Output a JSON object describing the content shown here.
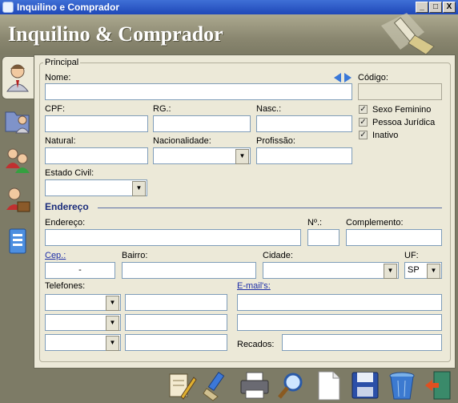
{
  "window": {
    "title": "Inquilino e Comprador",
    "buttons": {
      "minimize": "_",
      "maximize": "□",
      "close": "X"
    }
  },
  "header": {
    "title": "Inquilino & Comprador"
  },
  "sidebar": {
    "tabs": [
      {
        "icon": "person-icon"
      },
      {
        "icon": "folder-person-icon"
      },
      {
        "icon": "two-people-icon"
      },
      {
        "icon": "person-briefcase-icon"
      },
      {
        "icon": "document-book-icon"
      }
    ]
  },
  "form": {
    "group_label": "Principal",
    "nome_label": "Nome:",
    "nome_value": "",
    "codigo_label": "Código:",
    "codigo_value": "",
    "cpf_label": "CPF:",
    "rg_label": "RG.:",
    "nasc_label": "Nasc.:",
    "natural_label": "Natural:",
    "nacionalidade_label": "Nacionalidade:",
    "profissao_label": "Profissão:",
    "estado_civil_label": "Estado Civil:",
    "checkboxes": [
      {
        "label": "Sexo Feminino",
        "checked": true
      },
      {
        "label": "Pessoa Jurídica",
        "checked": true
      },
      {
        "label": "Inativo",
        "checked": true
      }
    ],
    "endereco_section": "Endereço",
    "endereco_label": "Endereço:",
    "numero_label": "Nº.:",
    "complemento_label": "Complemento:",
    "cep_label": "Cep.:",
    "cep_value": "-",
    "bairro_label": "Bairro:",
    "cidade_label": "Cidade:",
    "uf_label": "UF:",
    "uf_value": "SP",
    "telefones_label": "Telefones:",
    "emails_label": "E-mail's:",
    "recados_label": "Recados:"
  },
  "toolbar": {
    "buttons": [
      {
        "icon": "edit-document-icon"
      },
      {
        "icon": "brush-icon"
      },
      {
        "icon": "printer-icon"
      },
      {
        "icon": "search-icon"
      },
      {
        "icon": "new-document-icon"
      },
      {
        "icon": "save-icon"
      },
      {
        "icon": "trash-icon"
      },
      {
        "icon": "exit-door-icon"
      }
    ]
  },
  "colors": {
    "titlebar": "#2a58c8",
    "panel": "#ece9d8",
    "frame": "#7d7b66",
    "section": "#1b2d7c"
  }
}
